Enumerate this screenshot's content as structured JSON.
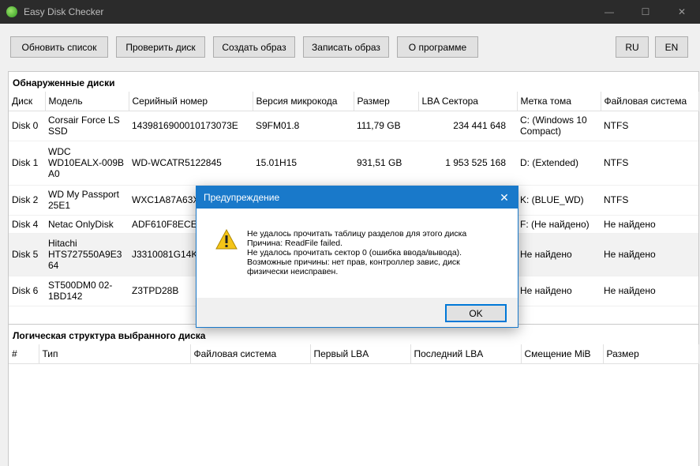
{
  "window": {
    "title": "Easy Disk Checker",
    "minimize": "—",
    "maximize": "☐",
    "close": "✕"
  },
  "toolbar": {
    "refresh": "Обновить список",
    "check": "Проверить диск",
    "create_image": "Создать образ",
    "write_image": "Записать образ",
    "about": "О программе",
    "lang_ru": "RU",
    "lang_en": "EN"
  },
  "disks": {
    "title": "Обнаруженные диски",
    "columns": [
      "Диск",
      "Модель",
      "Серийный номер",
      "Версия микрокода",
      "Размер",
      "LBA Сектора",
      "Метка тома",
      "Файловая система"
    ],
    "rows": [
      [
        "Disk 0",
        "Corsair Force LS SSD",
        "1439816900010173073E",
        "S9FM01.8",
        "111,79 GB",
        "234 441 648",
        "C: (Windows 10 Compact)",
        "NTFS"
      ],
      [
        "Disk 1",
        "WDC WD10EALX-009B A0",
        "WD-WCATR5122845",
        "15.01H15",
        "931,51 GB",
        "1 953 525 168",
        "D: (Extended)",
        "NTFS"
      ],
      [
        "Disk 2",
        "WD My Passport 25E1",
        "WXC1A87A63X",
        "",
        "",
        "",
        "K: (BLUE_WD)",
        "NTFS"
      ],
      [
        "Disk 4",
        "Netac OnlyDisk",
        "ADF610F8ECE4",
        "",
        "",
        "",
        "F: (Не найдено)",
        "Не найдено"
      ],
      [
        "Disk 5",
        "Hitachi HTS727550A9E3 64",
        "J3310081G14K",
        "",
        "",
        "",
        "Не найдено",
        "Не найдено"
      ],
      [
        "Disk 6",
        "ST500DM0 02-1BD142",
        "Z3TPD28B",
        "",
        "",
        "",
        "Не найдено",
        "Не найдено"
      ]
    ]
  },
  "partitions": {
    "title": "Логическая структура выбранного диска",
    "columns": [
      "#",
      "Тип",
      "Файловая система",
      "Первый LBA",
      "Последний LBA",
      "Смещение MiB",
      "Размер"
    ]
  },
  "dialog": {
    "title": "Предупреждение",
    "close": "✕",
    "message_lines": [
      "Не удалось прочитать таблицу разделов для этого диска",
      "Причина: ReadFile failed.",
      "Не удалось прочитать сектор 0 (ошибка ввода/вывода).",
      "Возможные причины: нет прав, контроллер завис, диск",
      "физически неисправен."
    ],
    "ok": "OK"
  }
}
